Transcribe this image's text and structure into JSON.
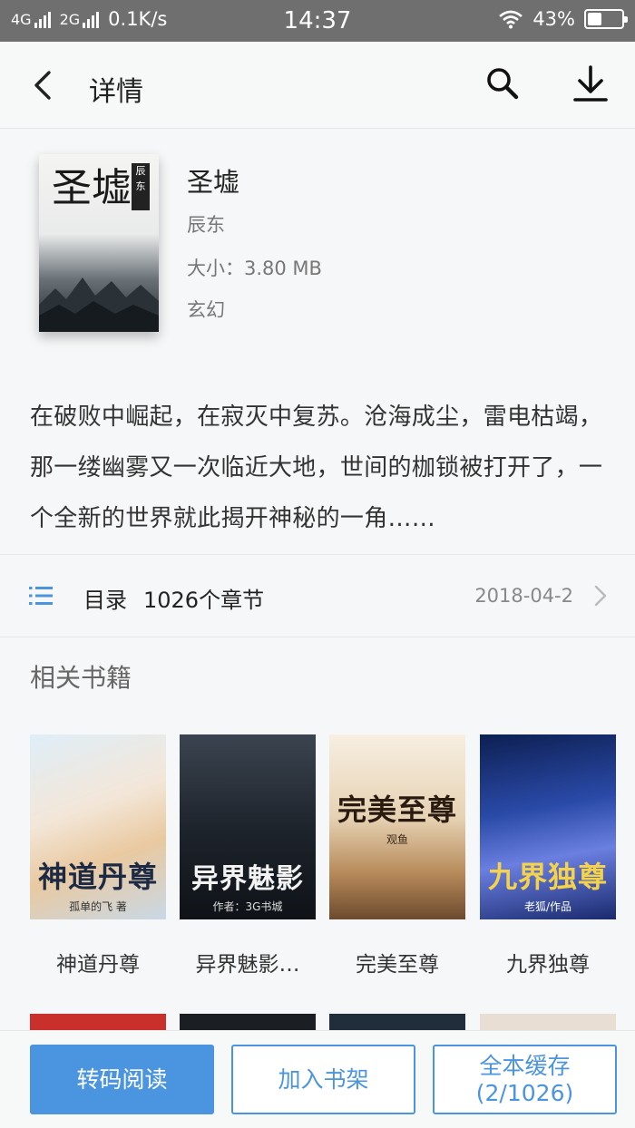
{
  "status_bar": {
    "net1": "4G",
    "net2": "2G",
    "speed": "0.1K/s",
    "time": "14:37",
    "battery": "43%",
    "battery_level": 0.43
  },
  "header": {
    "title": "详情",
    "icons": [
      "back-icon",
      "search-icon",
      "download-icon"
    ]
  },
  "book": {
    "title": "圣墟",
    "author": "辰东",
    "size": "大小：3.80 MB",
    "genre": "玄幻",
    "cover_title": "圣墟",
    "cover_tag": "辰东",
    "description": "在破败中崛起，在寂灭中复苏。沧海成尘，雷电枯竭，那一缕幽雾又一次临近大地，世间的枷锁被打开了，一个全新的世界就此揭开神秘的一角……"
  },
  "toc": {
    "label": "目录",
    "chapters": "1026个章节",
    "date": "2018-04-2"
  },
  "related": {
    "title": "相关书籍",
    "books": [
      {
        "name": "神道丹尊",
        "cover_text": "神道丹尊",
        "cover_sub": "孤单的飞 著"
      },
      {
        "name": "异界魅影…",
        "cover_text": "异界魅影",
        "cover_sub": "作者：3G书城"
      },
      {
        "name": "完美至尊",
        "cover_text": "完美至尊",
        "cover_sub": "观鱼"
      },
      {
        "name": "九界独尊",
        "cover_text": "九界独尊",
        "cover_sub": "老狐/作品"
      }
    ]
  },
  "bottom_bar": {
    "read_label": "转码阅读",
    "shelf_label": "加入书架",
    "cache_label": "全本缓存",
    "cache_progress": "(2/1026)"
  },
  "colors": {
    "accent": "#4a94e0",
    "statusbar": "#6f6f6f",
    "background": "#f6f7f8"
  }
}
